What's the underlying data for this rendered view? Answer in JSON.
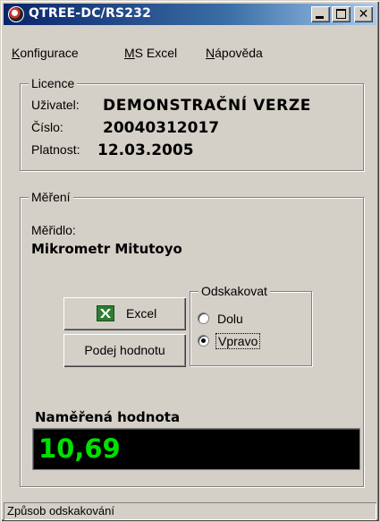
{
  "window": {
    "title": "QTREE-DC/RS232",
    "icons": {
      "app": "gear-app-icon",
      "minimize": "minimize-icon",
      "maximize": "maximize-icon",
      "close": "close-icon"
    }
  },
  "menu": {
    "items": [
      {
        "label": "Konfigurace",
        "hotkey": "K"
      },
      {
        "label": "MS Excel",
        "hotkey": "M"
      },
      {
        "label": "Nápověda",
        "hotkey": "N"
      }
    ]
  },
  "licence": {
    "legend": "Licence",
    "user_label": "Uživatel:",
    "user_value": "DEMONSTRAČNÍ VERZE",
    "number_label": "Číslo:",
    "number_value": "20040312017",
    "validity_label": "Platnost:",
    "validity_value": "12.03.2005"
  },
  "measurement": {
    "legend": "Měření",
    "gauge_label": "Měřidlo:",
    "gauge_value": "Mikrometr Mitutoyo",
    "excel_button": "Excel",
    "excel_icon": "excel-icon",
    "read_button": "Podej hodnotu",
    "jump": {
      "legend": "Odskakovat",
      "options": [
        "Dolu",
        "Vpravo"
      ],
      "selected": "Vpravo"
    },
    "value_label": "Naměřená hodnota",
    "value": "10,69",
    "value_color": "#00e000"
  },
  "status": {
    "text": "Způsob odskakování"
  }
}
